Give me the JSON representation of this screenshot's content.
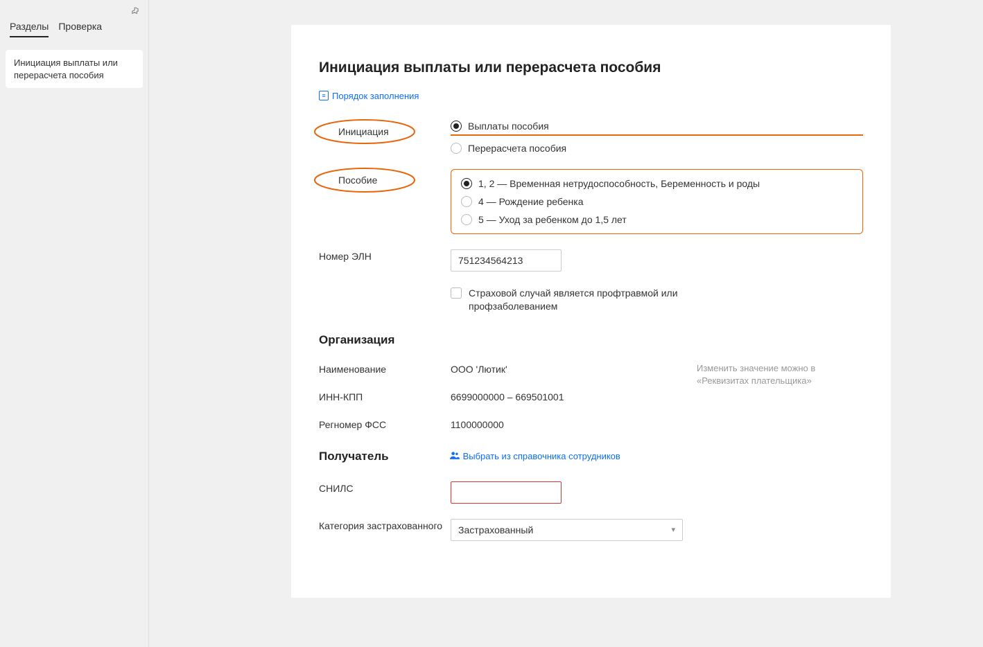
{
  "sidebar": {
    "tabs": [
      "Разделы",
      "Проверка"
    ],
    "item": "Инициация выплаты или перерасчета пособия"
  },
  "page": {
    "title": "Инициация выплаты или перерасчета пособия",
    "help_link": "Порядок заполнения"
  },
  "labels": {
    "initiation": "Инициация",
    "benefit": "Пособие",
    "eln": "Номер ЭЛН",
    "org_name": "Наименование",
    "inn_kpp": "ИНН-КПП",
    "regnum": "Регномер ФСС",
    "snils": "СНИЛС",
    "category": "Категория застрахованного"
  },
  "radios": {
    "initiation": {
      "opt1": "Выплаты пособия",
      "opt2": "Перерасчета пособия"
    },
    "benefit": {
      "opt1": "1, 2 — Временная нетрудоспособность, Беременность и роды",
      "opt2": "4 — Рождение ребенка",
      "opt3": "5 — Уход за ребенком до 1,5 лет"
    }
  },
  "values": {
    "eln": "751234564213",
    "insurance_case_label": "Страховой случай является профтравмой или профзаболеванием",
    "org_name": "ООО 'Лютик'",
    "inn_kpp": "6699000000  –  669501001",
    "regnum": "1100000000",
    "snils": "",
    "category": "Застрахованный"
  },
  "headings": {
    "organization": "Организация",
    "recipient": "Получатель"
  },
  "hints": {
    "org": "Изменить значение можно в «Реквизитах плательщика»",
    "select_employee": "Выбрать из справочника сотрудников"
  }
}
